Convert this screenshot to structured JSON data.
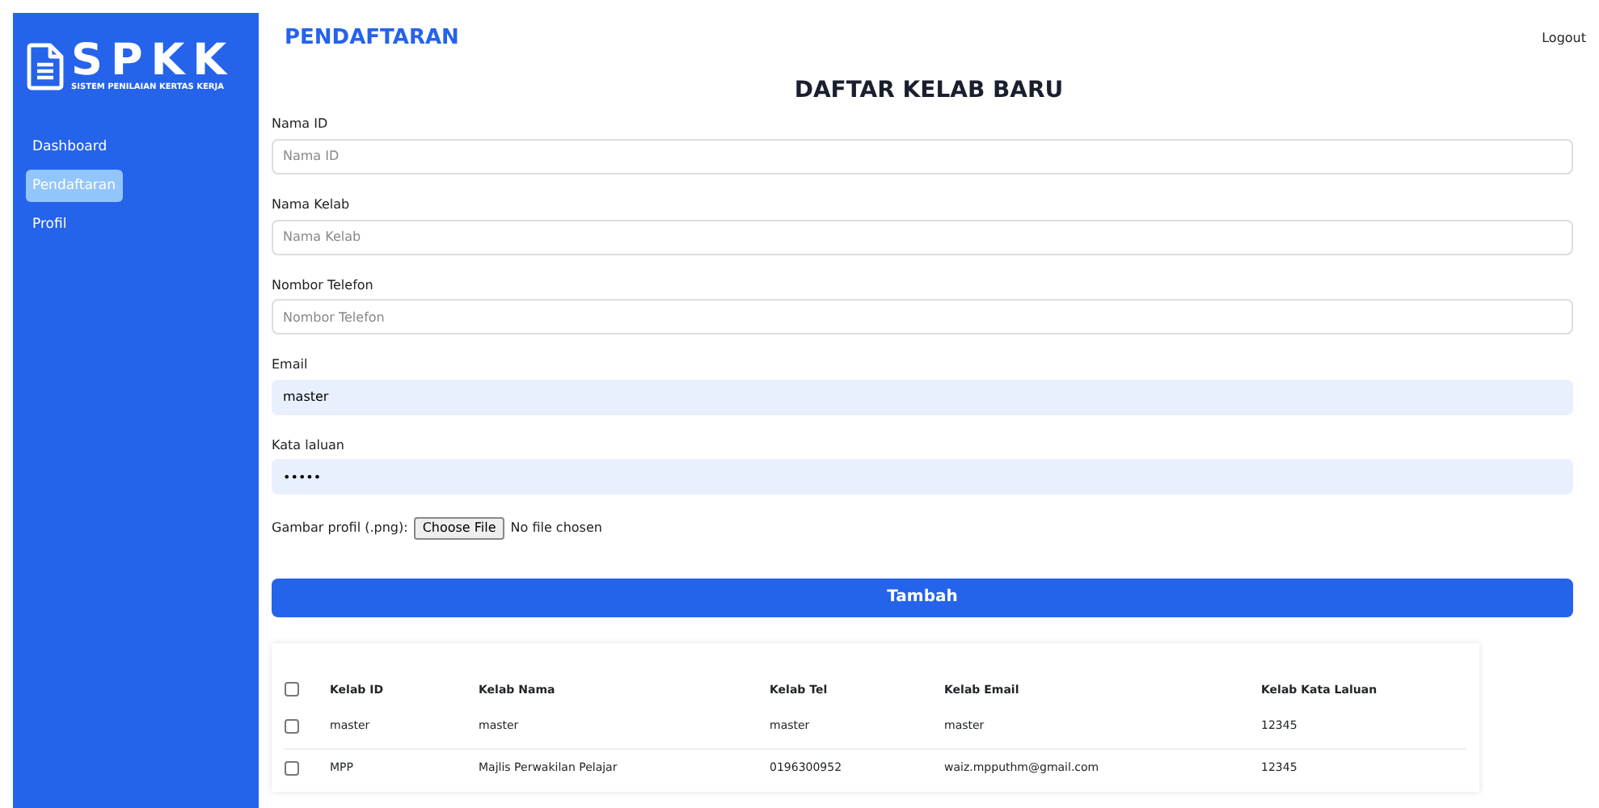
{
  "sidebar": {
    "logo_text": "SPKK",
    "logo_subtitle": "SISTEM PENILAIAN KERTAS KERJA",
    "items": [
      {
        "label": "Dashboard",
        "selected": false
      },
      {
        "label": "Pendaftaran",
        "selected": true
      },
      {
        "label": "Profil",
        "selected": false
      }
    ]
  },
  "header": {
    "title": "PENDAFTARAN",
    "logout": "Logout"
  },
  "form": {
    "title": "DAFTAR KELAB BARU",
    "fields": [
      {
        "label": "Nama ID",
        "placeholder": "Nama ID",
        "kind": "text"
      },
      {
        "label": "Nama Kelab",
        "placeholder": "Nama Kelab",
        "kind": "text"
      },
      {
        "label": "Nombor Telefon",
        "placeholder": "Nombor Telefon",
        "kind": "text"
      },
      {
        "label": "Email",
        "value": "master",
        "kind": "autofilled"
      },
      {
        "label": "Kata laluan",
        "value": "•••••",
        "kind": "autofilled"
      }
    ],
    "file": {
      "label": "Gambar profil (.png):",
      "button": "Choose File",
      "status": "No file chosen"
    },
    "submit": "Tambah"
  },
  "table": {
    "columns": [
      "Kelab ID",
      "Kelab Nama",
      "Kelab Tel",
      "Kelab Email",
      "Kelab Kata Laluan"
    ],
    "header_checked": false,
    "rows": [
      {
        "checked": false,
        "cells": [
          "master",
          "master",
          "master",
          "master",
          "12345"
        ]
      },
      {
        "checked": false,
        "cells": [
          "MPP",
          "Majlis Perwakilan Pelajar",
          "0196300952",
          "waiz.mpputhm@gmail.com",
          "12345"
        ]
      }
    ]
  }
}
